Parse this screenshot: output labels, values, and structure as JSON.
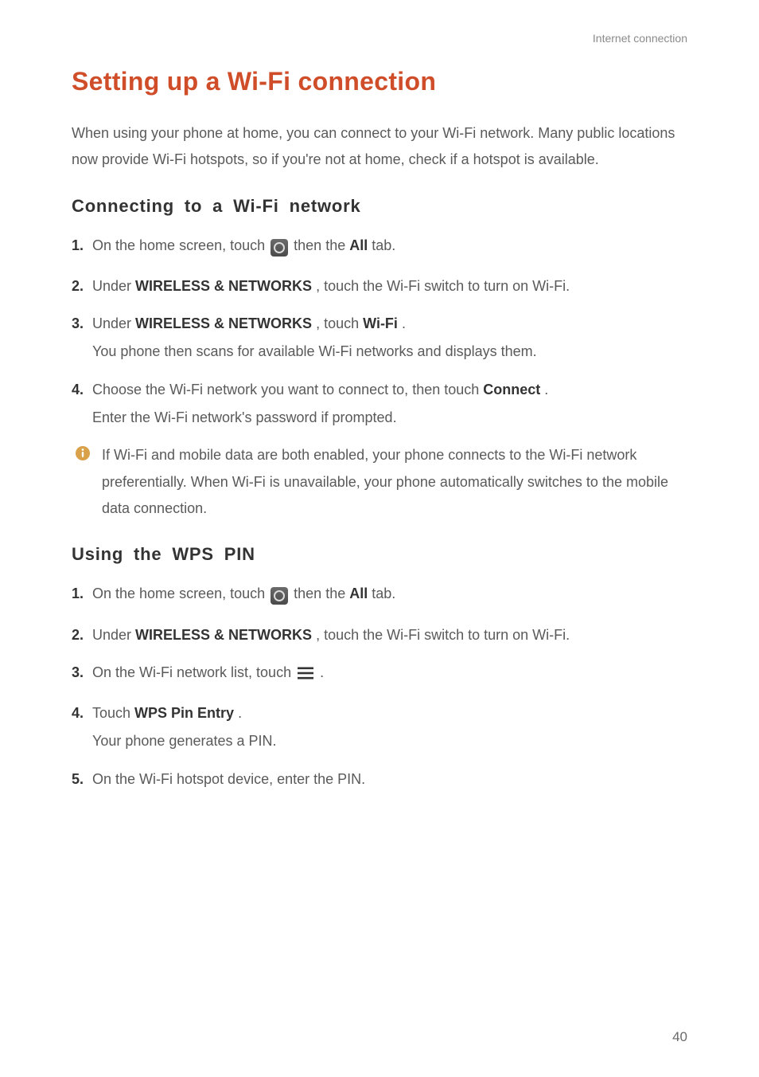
{
  "header": {
    "section_label": "Internet connection"
  },
  "title": "Setting up a Wi-Fi connection",
  "intro": "When using your phone at home, you can connect to your Wi-Fi network. Many public locations now provide Wi-Fi hotspots, so if you're not at home, check if a hotspot is available.",
  "section1": {
    "heading": "Connecting to a Wi-Fi network",
    "step1": {
      "num": "1.",
      "text_a": "On the home screen, touch ",
      "text_b": " then the ",
      "bold_all": "All",
      "text_c": " tab."
    },
    "step2": {
      "num": "2.",
      "text_a": "Under ",
      "bold_wn": "WIRELESS & NETWORKS",
      "text_b": ", touch the Wi-Fi switch to turn on Wi-Fi."
    },
    "step3": {
      "num": "3.",
      "text_a": "Under ",
      "bold_wn": "WIRELESS & NETWORKS",
      "text_b": ", touch ",
      "bold_wifi": "Wi-Fi",
      "text_c": ".",
      "sub": "You phone then scans for available Wi-Fi networks and displays them."
    },
    "step4": {
      "num": "4.",
      "text_a": "Choose the Wi-Fi network you want to connect to, then touch ",
      "bold_connect": "Connect",
      "text_b": ".",
      "sub": "Enter the Wi-Fi network's password if prompted."
    },
    "note": "If Wi-Fi and mobile data are both enabled, your phone connects to the Wi-Fi network preferentially. When Wi-Fi is unavailable, your phone automatically switches to the mobile data connection."
  },
  "section2": {
    "heading": "Using the WPS PIN",
    "step1": {
      "num": "1.",
      "text_a": "On the home screen, touch ",
      "text_b": " then the ",
      "bold_all": "All",
      "text_c": " tab."
    },
    "step2": {
      "num": "2.",
      "text_a": "Under ",
      "bold_wn": "WIRELESS & NETWORKS",
      "text_b": ", touch the Wi-Fi switch to turn on Wi-Fi."
    },
    "step3": {
      "num": "3.",
      "text_a": "On the Wi-Fi network list, touch ",
      "text_b": " ."
    },
    "step4": {
      "num": "4.",
      "text_a": "Touch ",
      "bold_wps": "WPS Pin Entry",
      "text_b": ".",
      "sub": "Your phone generates a PIN."
    },
    "step5": {
      "num": "5.",
      "text": "On the Wi-Fi hotspot device, enter the PIN."
    }
  },
  "page_number": "40"
}
